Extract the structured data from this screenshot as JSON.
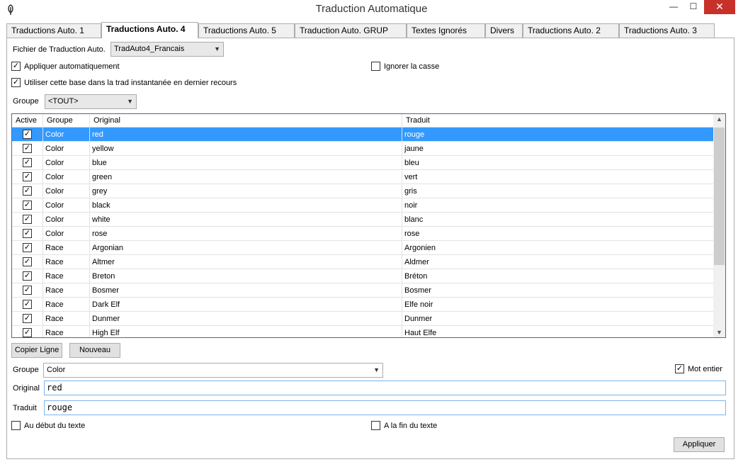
{
  "window": {
    "title": "Traduction Automatique",
    "min_glyph": "—",
    "max_glyph": "☐",
    "close_glyph": "✕"
  },
  "tabs": [
    {
      "label": "Traductions Auto. 1",
      "active": false
    },
    {
      "label": "Traductions Auto. 4",
      "active": true
    },
    {
      "label": "Traductions Auto. 5",
      "active": false
    },
    {
      "label": "Traduction Auto. GRUP",
      "active": false
    },
    {
      "label": "Textes Ignorés",
      "active": false
    },
    {
      "label": "Divers",
      "active": false
    },
    {
      "label": "Traductions Auto. 2",
      "active": false
    },
    {
      "label": "Traductions Auto. 3",
      "active": false
    }
  ],
  "top": {
    "file_label": "Fichier de Traduction Auto.",
    "file_value": "TradAuto4_Francais",
    "auto_apply_label": "Appliquer automatiquement",
    "auto_apply_checked": true,
    "ignore_case_label": "Ignorer la casse",
    "ignore_case_checked": false,
    "use_base_label": "Utiliser cette base dans la trad instantanée en dernier recours",
    "use_base_checked": true,
    "group_label": "Groupe",
    "group_value": "<TOUT>"
  },
  "grid": {
    "columns": [
      "Active",
      "Groupe",
      "Original",
      "Traduit"
    ],
    "rows": [
      {
        "active": true,
        "groupe": "Color",
        "original": "red",
        "traduit": "rouge",
        "selected": true
      },
      {
        "active": true,
        "groupe": "Color",
        "original": "yellow",
        "traduit": "jaune"
      },
      {
        "active": true,
        "groupe": "Color",
        "original": "blue",
        "traduit": "bleu"
      },
      {
        "active": true,
        "groupe": "Color",
        "original": "green",
        "traduit": "vert"
      },
      {
        "active": true,
        "groupe": "Color",
        "original": "grey",
        "traduit": "gris"
      },
      {
        "active": true,
        "groupe": "Color",
        "original": "black",
        "traduit": "noir"
      },
      {
        "active": true,
        "groupe": "Color",
        "original": "white",
        "traduit": "blanc"
      },
      {
        "active": true,
        "groupe": "Color",
        "original": "rose",
        "traduit": "rose"
      },
      {
        "active": true,
        "groupe": "Race",
        "original": "Argonian",
        "traduit": "Argonien"
      },
      {
        "active": true,
        "groupe": "Race",
        "original": "Altmer",
        "traduit": "Aldmer"
      },
      {
        "active": true,
        "groupe": "Race",
        "original": "Breton",
        "traduit": "Bréton"
      },
      {
        "active": true,
        "groupe": "Race",
        "original": "Bosmer",
        "traduit": "Bosmer"
      },
      {
        "active": true,
        "groupe": "Race",
        "original": "Dark Elf",
        "traduit": "Elfe noir"
      },
      {
        "active": true,
        "groupe": "Race",
        "original": "Dunmer",
        "traduit": "Dunmer"
      },
      {
        "active": true,
        "groupe": "Race",
        "original": "High Elf",
        "traduit": "Haut Elfe"
      }
    ]
  },
  "buttons": {
    "copy_line": "Copier Ligne",
    "new": "Nouveau",
    "apply": "Appliquer"
  },
  "edit": {
    "group_label": "Groupe",
    "group_value": "Color",
    "whole_word_label": "Mot entier",
    "whole_word_checked": true,
    "original_label": "Original",
    "original_value": "red",
    "traduit_label": "Traduit",
    "traduit_value": "rouge",
    "start_label": "Au début du texte",
    "start_checked": false,
    "end_label": "A la fin du texte",
    "end_checked": false
  },
  "colors": {
    "selection": "#3399ff",
    "close_button": "#c7312a",
    "textbox_border": "#7eb4ea"
  }
}
